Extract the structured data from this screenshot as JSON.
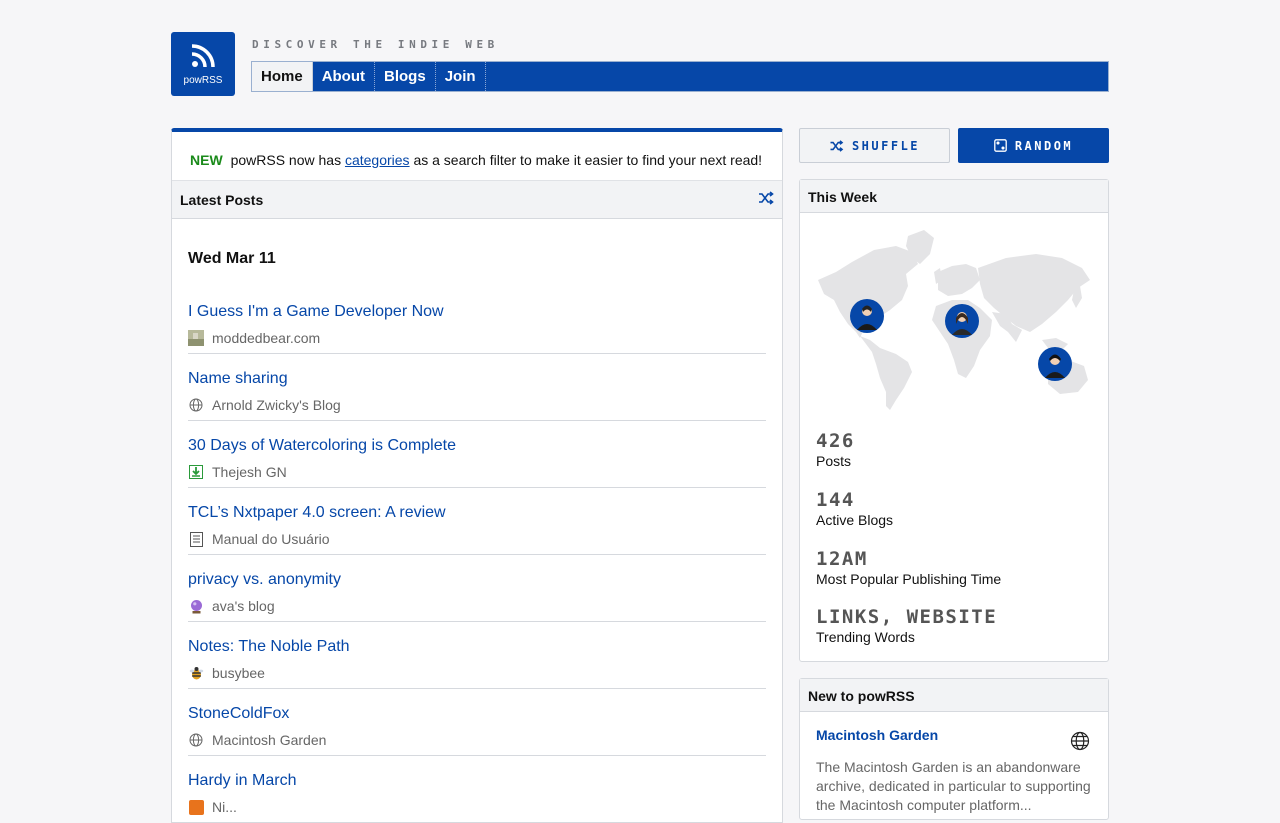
{
  "header": {
    "logo_text": "powRSS",
    "tagline": "DISCOVER THE INDIE WEB",
    "nav": [
      {
        "label": "Home",
        "active": true
      },
      {
        "label": "About"
      },
      {
        "label": "Blogs"
      },
      {
        "label": "Join"
      }
    ]
  },
  "notice": {
    "badge": "NEW",
    "text_before": "powRSS now has",
    "link": "categories",
    "text_after": "as a search filter to make it easier to find your next read!"
  },
  "latest": {
    "title": "Latest Posts",
    "date": "Wed Mar 11",
    "posts": [
      {
        "title": "I Guess I'm a Game Developer Now",
        "source": "moddedbear.com",
        "icon": "site-avatar-icon"
      },
      {
        "title": "Name sharing",
        "source": "Arnold Zwicky's Blog",
        "icon": "globe-icon"
      },
      {
        "title": "30 Days of Watercoloring is Complete",
        "source": "Thejesh GN",
        "icon": "download-box-icon"
      },
      {
        "title": "TCL’s Nxtpaper 4.0 screen: A review",
        "source": "Manual do Usuário",
        "icon": "document-icon"
      },
      {
        "title": "privacy vs. anonymity",
        "source": "ava's blog",
        "icon": "crystal-ball-icon"
      },
      {
        "title": "Notes: The Noble Path",
        "source": "busybee",
        "icon": "bee-icon"
      },
      {
        "title": "StoneColdFox",
        "source": "Macintosh Garden",
        "icon": "globe-icon"
      },
      {
        "title": "Hardy in March",
        "source": "Ni...",
        "icon": "rss-icon"
      }
    ]
  },
  "buttons": {
    "shuffle": "SHUFFLE",
    "random": "RANDOM"
  },
  "this_week": {
    "title": "This Week",
    "stats": [
      {
        "value": "426",
        "label": "Posts"
      },
      {
        "value": "144",
        "label": "Active Blogs"
      },
      {
        "value": "12AM",
        "label": "Most Popular Publishing Time"
      },
      {
        "value": "LINKS, WEBSITE",
        "label": "Trending Words"
      }
    ]
  },
  "new_to": {
    "title": "New to powRSS",
    "site": "Macintosh Garden",
    "description": "The Macintosh Garden is an abandonware archive, dedicated in particular to supporting the Macintosh computer platform..."
  },
  "colors": {
    "brand": "#0647a8",
    "new_badge": "#1a8a1a"
  }
}
